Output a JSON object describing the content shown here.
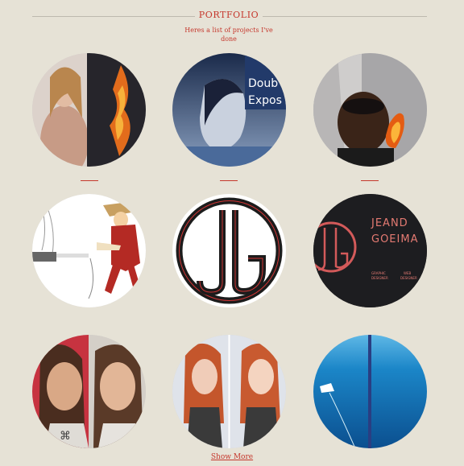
{
  "header": {
    "title": "PORTFOLIO",
    "subtitle": "Heres a list of projects I've done"
  },
  "projects": [
    {
      "name": "dark-fire-portrait"
    },
    {
      "name": "double-exposure",
      "text_line1": "Doub",
      "text_line2": "Expos"
    },
    {
      "name": "fire-hand-selfie"
    },
    {
      "name": "samurai-illustration"
    },
    {
      "name": "jg-logo"
    },
    {
      "name": "business-card",
      "name_line1": "JEAND",
      "name_line2": "GOEIMA",
      "role1_line1": "GRAPHIC",
      "role1_line2": "DESIGNER",
      "role2_line1": "WEB",
      "role2_line2": "DESIGNER"
    },
    {
      "name": "woman-retouch-before-after"
    },
    {
      "name": "redhead-retouch-before-after"
    },
    {
      "name": "ocean-boat"
    }
  ],
  "footer": {
    "show_more_label": "Show More"
  },
  "colors": {
    "accent": "#c5372c",
    "background": "#e6e2d6"
  }
}
